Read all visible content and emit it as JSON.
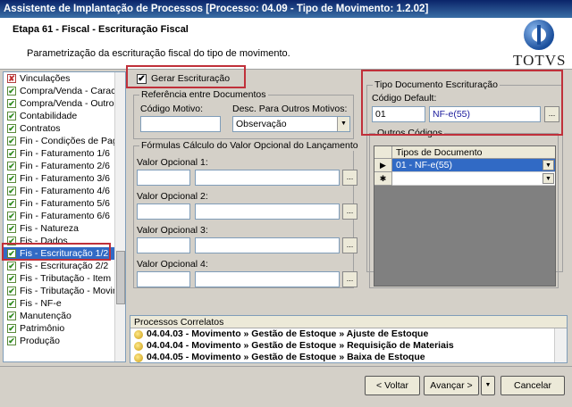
{
  "window": {
    "title": "Assistente de Implantação de Processos [Processo: 04.09 - Tipo de Movimento: 1.2.02]"
  },
  "header": {
    "step_title": "Etapa 61 - Fiscal - Escrituração Fiscal",
    "description": "Parametrização da escrituração fiscal do tipo de movimento.",
    "logo_text": "TOTVS"
  },
  "sidebar": {
    "items": [
      {
        "label": "Vinculações",
        "state": "error"
      },
      {
        "label": "Compra/Venda - Caracte",
        "state": "ok"
      },
      {
        "label": "Compra/Venda - Outros",
        "state": "ok"
      },
      {
        "label": "Contabilidade",
        "state": "ok"
      },
      {
        "label": "Contratos",
        "state": "ok"
      },
      {
        "label": "Fin - Condições de Pagar",
        "state": "ok"
      },
      {
        "label": "Fin - Faturamento 1/6",
        "state": "ok"
      },
      {
        "label": "Fin - Faturamento 2/6",
        "state": "ok"
      },
      {
        "label": "Fin - Faturamento 3/6",
        "state": "ok"
      },
      {
        "label": "Fin - Faturamento 4/6",
        "state": "ok"
      },
      {
        "label": "Fin - Faturamento 5/6",
        "state": "ok"
      },
      {
        "label": "Fin - Faturamento 6/6",
        "state": "ok"
      },
      {
        "label": "Fis - Natureza",
        "state": "ok"
      },
      {
        "label": "Fis - Dados",
        "state": "ok"
      },
      {
        "label": "Fis - Escrituração 1/2",
        "state": "ok",
        "selected": true
      },
      {
        "label": "Fis - Escrituração 2/2",
        "state": "ok"
      },
      {
        "label": "Fis - Tributação - Item",
        "state": "ok"
      },
      {
        "label": "Fis - Tributação - Movime",
        "state": "ok"
      },
      {
        "label": "Fis - NF-e",
        "state": "ok"
      },
      {
        "label": "Manutenção",
        "state": "ok"
      },
      {
        "label": "Patrimônio",
        "state": "ok"
      },
      {
        "label": "Produção",
        "state": "ok"
      }
    ]
  },
  "form": {
    "gerar_escrituracao": {
      "label": "Gerar Escrituração",
      "checked": true
    },
    "referencia": {
      "title": "Referência entre Documentos",
      "codigo_motivo_label": "Código Motivo:",
      "codigo_motivo_value": "",
      "desc_label": "Desc. Para Outros Motivos:",
      "desc_value": "Observação"
    },
    "formulas": {
      "title": "Fórmulas Cálculo do Valor Opcional do Lançamento",
      "fields": [
        {
          "label": "Valor Opcional 1:"
        },
        {
          "label": "Valor Opcional 2:"
        },
        {
          "label": "Valor Opcional 3:"
        },
        {
          "label": "Valor Opcional 4:"
        }
      ]
    },
    "tipo_documento": {
      "title": "Tipo Documento Escrituração",
      "codigo_default_label": "Código Default:",
      "codigo_value": "01",
      "descricao_value": "NF-e(55)"
    },
    "outros_codigos": {
      "title": "Outros Códigos",
      "column_header": "Tipos de Documento",
      "rows": [
        {
          "marker": "▶",
          "value": "01 - NF-e(55)"
        },
        {
          "marker": "✱",
          "value": ""
        }
      ]
    }
  },
  "processos_correlatos": {
    "title": "Processos Correlatos",
    "items": [
      {
        "label": "04.04.03 - Movimento » Gestão de Estoque » Ajuste de Estoque"
      },
      {
        "label": "04.04.04 - Movimento » Gestão de Estoque » Requisição de Materiais"
      },
      {
        "label": "04.04.05 - Movimento » Gestão de Estoque » Baixa de Estoque"
      }
    ]
  },
  "footer": {
    "back_label": "< Voltar",
    "next_label": "Avançar >",
    "cancel_label": "Cancelar"
  },
  "colors": {
    "title_bar": "#0a246a",
    "highlight_box": "#c0303a",
    "selection": "#316ac5"
  }
}
